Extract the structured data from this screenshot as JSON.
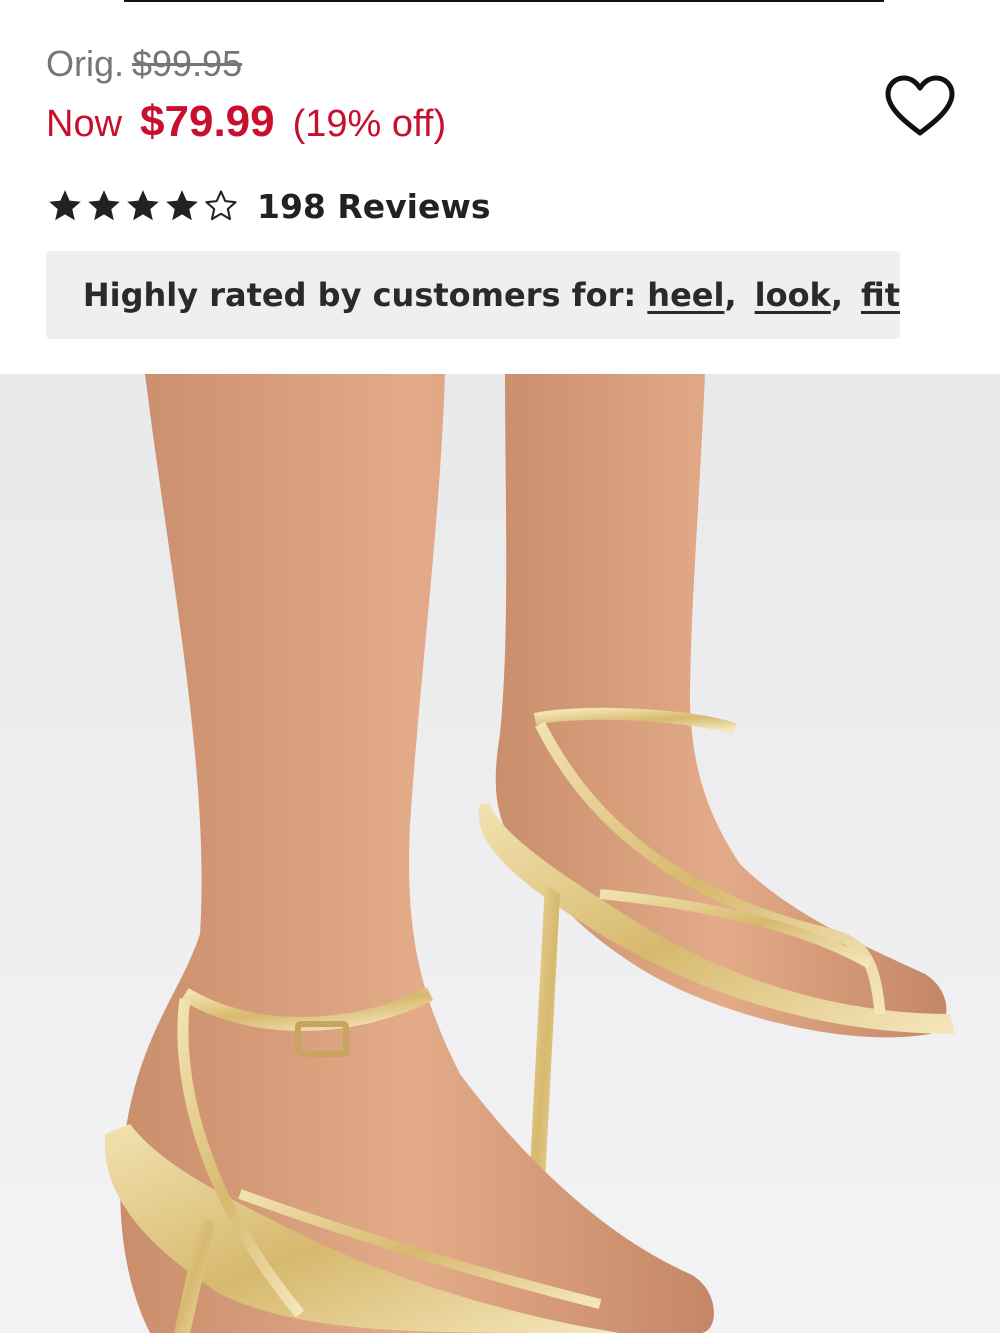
{
  "pricing": {
    "orig_label": "Orig.",
    "orig_price": "$99.95",
    "now_label": "Now",
    "now_price": "$79.99",
    "discount": "(19% off)",
    "sale_color": "#c8102e"
  },
  "wishlist": {
    "icon": "heart-outline-icon"
  },
  "rating": {
    "value": 4,
    "max": 5,
    "reviews_label": "198 Reviews"
  },
  "highlights": {
    "icon": "sparkle-icon",
    "label": "Highly rated by customers for:",
    "tags": [
      "heel",
      "look",
      "fit"
    ]
  },
  "product_image": {
    "alt": "gold strappy heeled sandals"
  }
}
